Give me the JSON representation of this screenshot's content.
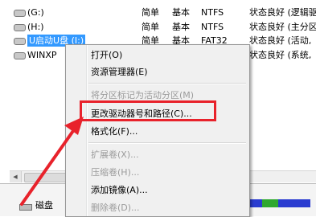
{
  "volumes": [
    {
      "name": "(G:)",
      "layout": "简单",
      "type": "基本",
      "fs": "NTFS",
      "status": "状态良好 (逻辑驱"
    },
    {
      "name": "(H:)",
      "layout": "简单",
      "type": "基本",
      "fs": "NTFS",
      "status": "状态良好 (主分区"
    },
    {
      "name": "U启动U盘 (I:)",
      "layout": "简单",
      "type": "基本",
      "fs": "FAT32",
      "status": "状态良好 (活动,"
    },
    {
      "name": "WINXP",
      "layout": "",
      "type": "",
      "fs": "",
      "status": "状态良好 (系统,"
    }
  ],
  "context_menu": {
    "open": "打开(O)",
    "explorer": "资源管理器(E)",
    "mark_active": "将分区标记为活动分区(M)",
    "change_letter": "更改驱动器号和路径(C)...",
    "format": "格式化(F)...",
    "extend": "扩展卷(X)...",
    "shrink": "压缩卷(H)...",
    "add_mirror": "添加镜像(A)...",
    "delete": "删除卷(D)..."
  },
  "bottom": {
    "disk_label": "磁盘"
  },
  "colors": {
    "annotation": "#e8222b",
    "selection": "#3399ff",
    "primary_bar": "#2a3cd0",
    "logical_bar": "#2fa82f"
  },
  "icons": {
    "volume": "drive-icon",
    "disk": "disk-icon",
    "arrow": "annotation-arrow"
  }
}
